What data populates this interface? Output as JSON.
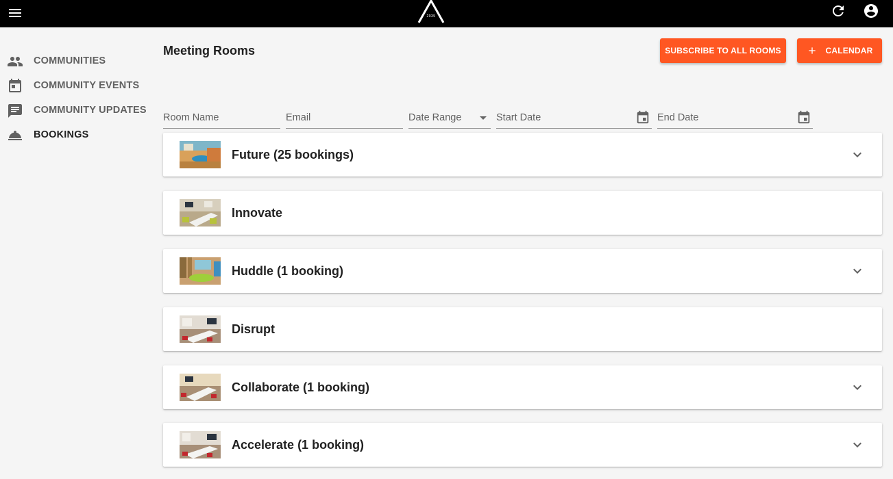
{
  "topbar": {
    "logo_text": "2035",
    "icons": {
      "menu": "menu-icon",
      "refresh": "refresh-icon",
      "account": "account-circle-icon"
    }
  },
  "sidebar": {
    "items": [
      {
        "label": "COMMUNITIES",
        "icon": "people-icon",
        "active": false
      },
      {
        "label": "COMMUNITY EVENTS",
        "icon": "event-icon",
        "active": false
      },
      {
        "label": "COMMUNITY UPDATES",
        "icon": "chat-icon",
        "active": false
      },
      {
        "label": "BOOKINGS",
        "icon": "room-service-icon",
        "active": true
      }
    ]
  },
  "main": {
    "title": "Meeting Rooms",
    "subscribe_label": "SUBSCRIBE TO ALL ROOMS",
    "calendar_label": "CALENDAR",
    "filters": {
      "room_name": "Room Name",
      "email": "Email",
      "date_range": "Date Range",
      "start_date": "Start Date",
      "end_date": "End Date"
    },
    "rooms": [
      {
        "title": "Future (25 bookings)",
        "expandable": true
      },
      {
        "title": "Innovate",
        "expandable": false
      },
      {
        "title": "Huddle (1 booking)",
        "expandable": true
      },
      {
        "title": "Disrupt",
        "expandable": false
      },
      {
        "title": "Collaborate (1 booking)",
        "expandable": true
      },
      {
        "title": "Accelerate (1 booking)",
        "expandable": true
      }
    ]
  },
  "colors": {
    "accent": "#ff5722",
    "topbar": "#000000",
    "background": "#f5f5f5"
  }
}
